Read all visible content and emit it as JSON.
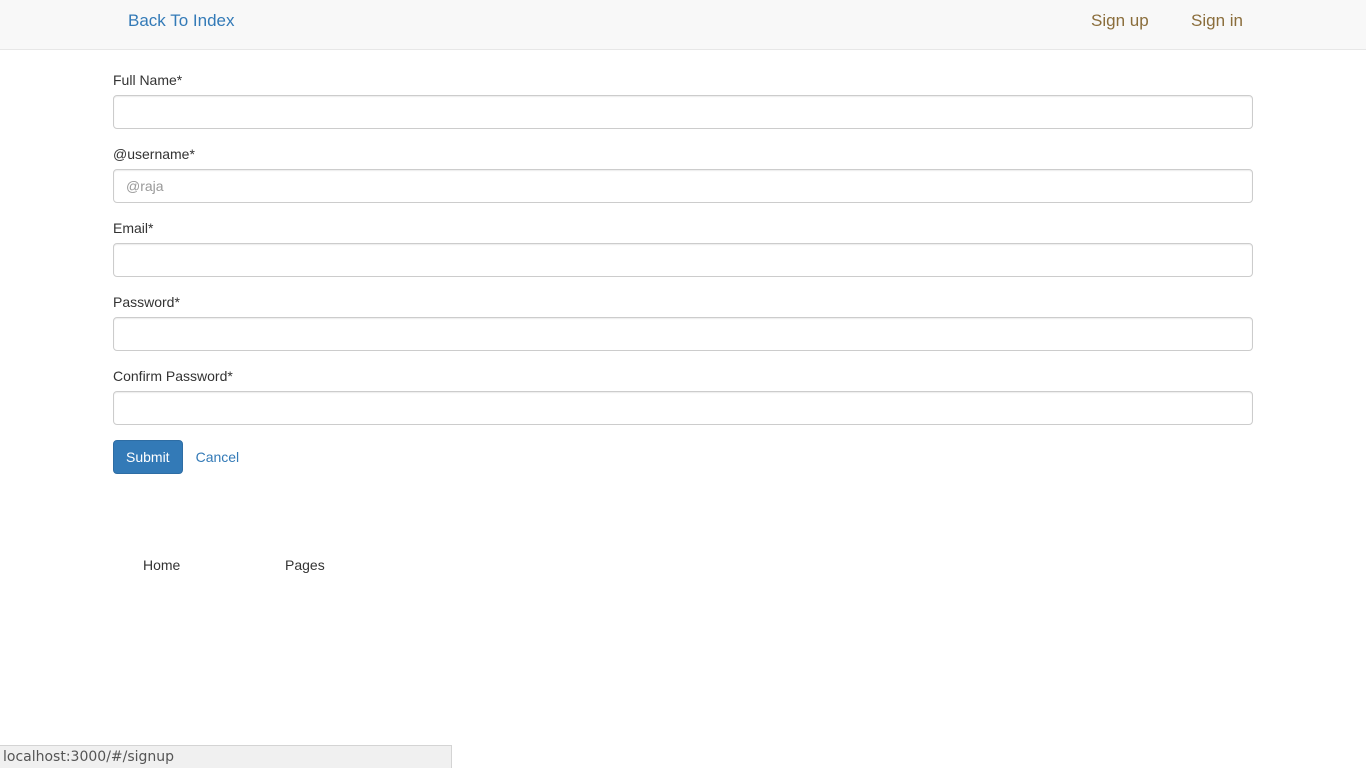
{
  "navbar": {
    "back_label": "Back To Index",
    "signup_label": "Sign up",
    "signin_label": "Sign in"
  },
  "form": {
    "fields": [
      {
        "label": "Full Name*",
        "value": "",
        "placeholder": ""
      },
      {
        "label": "@username*",
        "value": "",
        "placeholder": "@raja"
      },
      {
        "label": "Email*",
        "value": "",
        "placeholder": ""
      },
      {
        "label": "Password*",
        "value": "",
        "placeholder": ""
      },
      {
        "label": "Confirm Password*",
        "value": "",
        "placeholder": ""
      }
    ],
    "submit_label": "Submit",
    "cancel_label": "Cancel"
  },
  "footer": {
    "home_label": "Home",
    "pages_label": "Pages"
  },
  "status_bar": {
    "url": "localhost:3000/#/signup"
  },
  "colors": {
    "link": "#337ab7",
    "nav_link": "#8a6d3b",
    "primary_button": "#337ab7",
    "navbar_bg": "#f8f8f8"
  }
}
